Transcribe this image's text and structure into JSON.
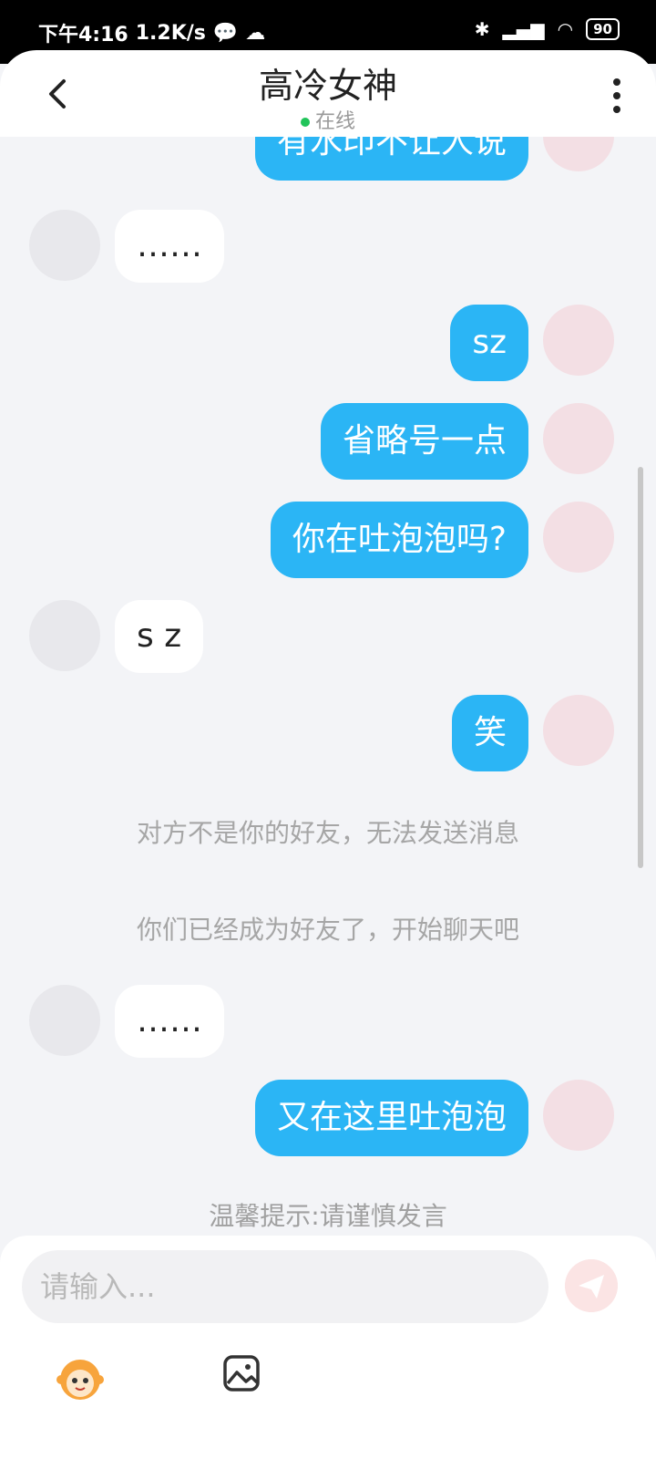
{
  "status": {
    "time": "下午4:16",
    "speed": "1.2K/s",
    "battery": "90"
  },
  "header": {
    "title": "高冷女神",
    "status": "在线"
  },
  "messages": [
    {
      "side": "me",
      "text": "有水印不让人说"
    },
    {
      "side": "other",
      "text": "……"
    },
    {
      "side": "me",
      "text": "sz"
    },
    {
      "side": "me",
      "text": "省略号一点"
    },
    {
      "side": "me",
      "text": "你在吐泡泡吗?"
    },
    {
      "side": "other",
      "text": "s z"
    },
    {
      "side": "me",
      "text": "笑"
    },
    {
      "side": "system",
      "text": "对方不是你的好友，无法发送消息"
    },
    {
      "side": "system",
      "text": "你们已经成为好友了，开始聊天吧"
    },
    {
      "side": "other",
      "text": "……"
    },
    {
      "side": "me",
      "text": "又在这里吐泡泡"
    }
  ],
  "tip": "温馨提示:请谨慎发言",
  "input": {
    "placeholder": "请输入..."
  },
  "colors": {
    "bubble_me": "#2bb5f5",
    "online_dot": "#21c45a",
    "send_button": "#fbe4e4"
  }
}
